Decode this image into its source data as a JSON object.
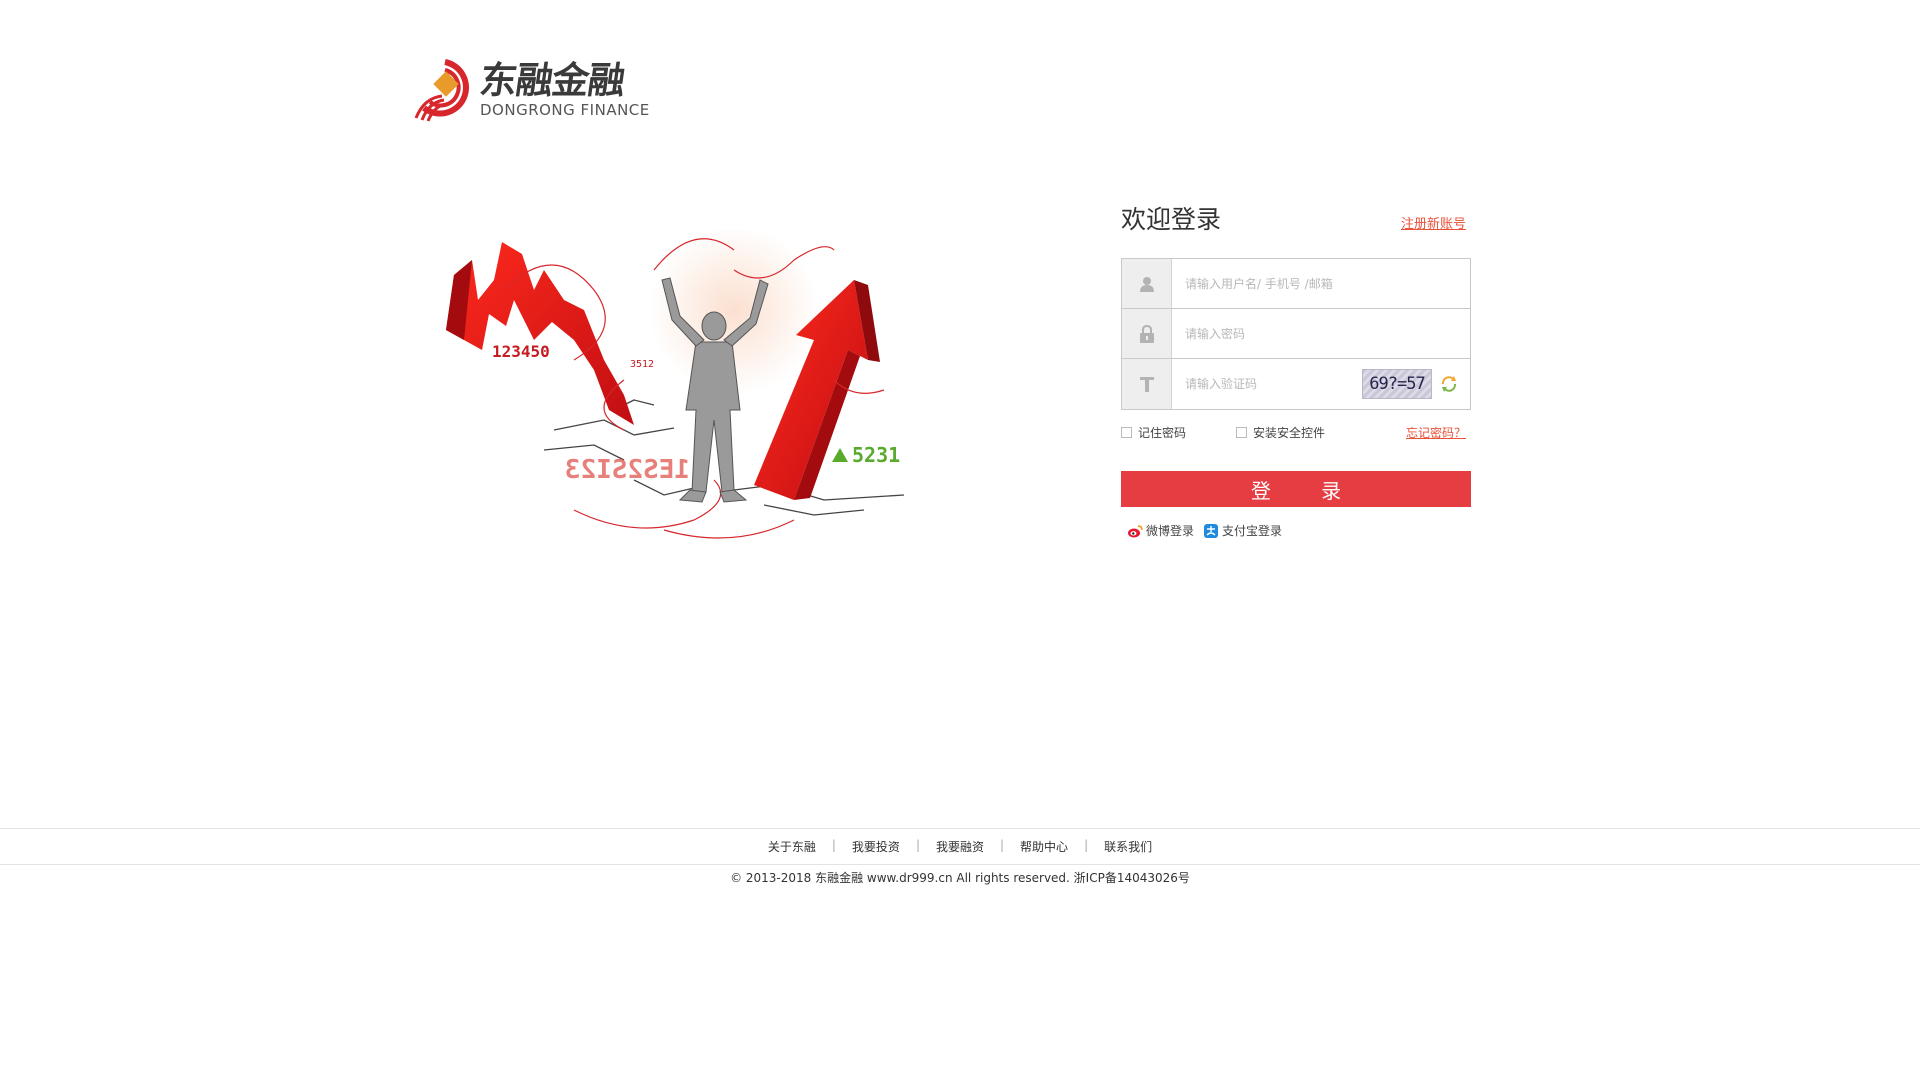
{
  "logo": {
    "cn": "东融金融",
    "en": "DONGRONG FINANCE"
  },
  "hero": {
    "number_left": "123450",
    "number_small": "3512",
    "number_mirror": "1ES2SI23",
    "number_right": "5231"
  },
  "login": {
    "title": "欢迎登录",
    "register": "注册新账号",
    "username_placeholder": "请输入用户名/ 手机号 /邮箱",
    "password_placeholder": "请输入密码",
    "captcha_placeholder": "请输入验证码",
    "captcha_text": "69?=57",
    "remember": "记住密码",
    "install": "安装安全控件",
    "forgot": "忘记密码？",
    "submit": "登 录",
    "weibo": "微博登录",
    "alipay": "支付宝登录"
  },
  "footer": {
    "links": [
      "关于东融",
      "我要投资",
      "我要融资",
      "帮助中心",
      "联系我们"
    ],
    "copyright": "© 2013-2018 东融金融 www.dr999.cn  All rights reserved. 浙ICP备14043026号"
  },
  "colors": {
    "accent": "#e63d42",
    "link": "#e8523b",
    "logo_red": "#d7262c"
  }
}
